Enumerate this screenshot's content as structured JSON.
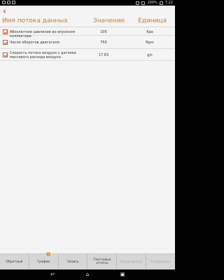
{
  "status_bar": {
    "time": "7:22",
    "battery": "100%"
  },
  "header": {
    "col_name": "Имя потока данных",
    "col_value": "Значение",
    "col_unit": "Единица"
  },
  "rows": [
    {
      "name": "Абсолютное давление во впускном коллекторе",
      "value": "105",
      "unit": "Kpa",
      "checked": true
    },
    {
      "name": "Число оборотов двигателя",
      "value": "750",
      "unit": "Rpm",
      "checked": true
    },
    {
      "name": "Скорость потока воздуха с датчика массового расхода воздуха",
      "value": "17.83",
      "unit": "g/s",
      "checked": true
    }
  ],
  "toolbar": {
    "btn1": "Обратный",
    "btn2": "График",
    "btn2_badge": "3",
    "btn3": "Запись",
    "btn4": "Текстовые отчёты",
    "btn5": "Предыдущая",
    "btn6": "Следующая"
  },
  "icons": {
    "back": "back-arrow-icon",
    "nav_back": "nav-back-icon",
    "nav_home": "nav-home-icon",
    "nav_recent": "nav-recent-apps-icon"
  },
  "colors": {
    "accent": "#e8562a",
    "header_text": "#e0782a",
    "badge": "#f08a24"
  }
}
